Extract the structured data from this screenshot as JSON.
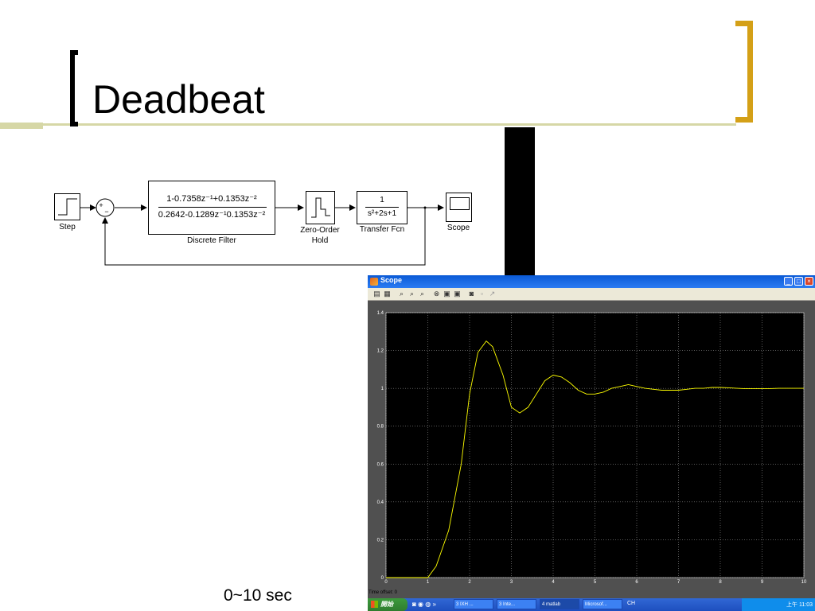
{
  "slide": {
    "title": "Deadbeat",
    "footnote": "0~10 sec"
  },
  "diagram": {
    "step_label": "Step",
    "sum_plus": "+",
    "sum_minus": "−",
    "filter_num": "1-0.7358z⁻¹+0.1353z⁻²",
    "filter_den": "0.2642-0.1289z⁻¹0.1353z⁻²",
    "filter_label": "Discrete Filter",
    "zoh_label_1": "Zero-Order",
    "zoh_label_2": "Hold",
    "tf_num": "1",
    "tf_den": "s²+2s+1",
    "tf_label": "Transfer Fcn",
    "scope_label": "Scope"
  },
  "scope_window": {
    "title": "Scope",
    "time_offset": "Time offset:  0",
    "titlebar_color": "#0a5ad6",
    "trace_color": "#ffff00",
    "toolbar_icons": [
      "print-icon",
      "params-icon",
      "zoom-icon",
      "zoom-x-icon",
      "zoom-y-icon",
      "autoscale-icon",
      "save-axes-icon",
      "restore-axes-icon",
      "floating-icon",
      "lock-icon",
      "signal-select-icon"
    ]
  },
  "taskbar": {
    "start_label": "開始",
    "items": [
      "3 IXH ...",
      "3 Inte...",
      "4 matlab",
      "Microsof..."
    ],
    "lang": "CH",
    "clock": "上午 11:03"
  },
  "chart_data": {
    "type": "line",
    "title": "",
    "xlabel": "",
    "ylabel": "",
    "xlim": [
      0,
      10
    ],
    "ylim": [
      0,
      1.4
    ],
    "xticks": [
      "0",
      "1",
      "2",
      "3",
      "4",
      "5",
      "6",
      "7",
      "8",
      "9",
      "10"
    ],
    "yticks": [
      "0",
      "0.2",
      "0.4",
      "0.6",
      "0.8",
      "1",
      "1.2",
      "1.4"
    ],
    "grid": true,
    "series": [
      {
        "color": "#ffff00",
        "x": [
          0,
          1,
          1.2,
          1.5,
          1.8,
          2.0,
          2.2,
          2.4,
          2.55,
          2.8,
          3.0,
          3.2,
          3.4,
          3.6,
          3.8,
          4.0,
          4.2,
          4.4,
          4.6,
          4.8,
          5.0,
          5.2,
          5.4,
          5.6,
          5.8,
          6.0,
          6.2,
          6.4,
          6.6,
          6.8,
          7.0,
          7.2,
          7.4,
          7.6,
          7.8,
          8.0,
          8.2,
          8.4,
          8.6,
          8.8,
          9.0,
          9.2,
          9.4,
          9.6,
          9.8,
          10.0
        ],
        "y": [
          0,
          0,
          0.06,
          0.25,
          0.6,
          0.97,
          1.19,
          1.25,
          1.22,
          1.07,
          0.9,
          0.87,
          0.9,
          0.97,
          1.04,
          1.07,
          1.06,
          1.03,
          0.99,
          0.97,
          0.97,
          0.98,
          1.0,
          1.01,
          1.02,
          1.01,
          1.0,
          0.995,
          0.99,
          0.99,
          0.99,
          0.995,
          1.0,
          1.0,
          1.005,
          1.005,
          1.003,
          1.0,
          0.998,
          0.998,
          0.998,
          0.999,
          1.0,
          1.0,
          1.0,
          1.0
        ]
      }
    ]
  }
}
